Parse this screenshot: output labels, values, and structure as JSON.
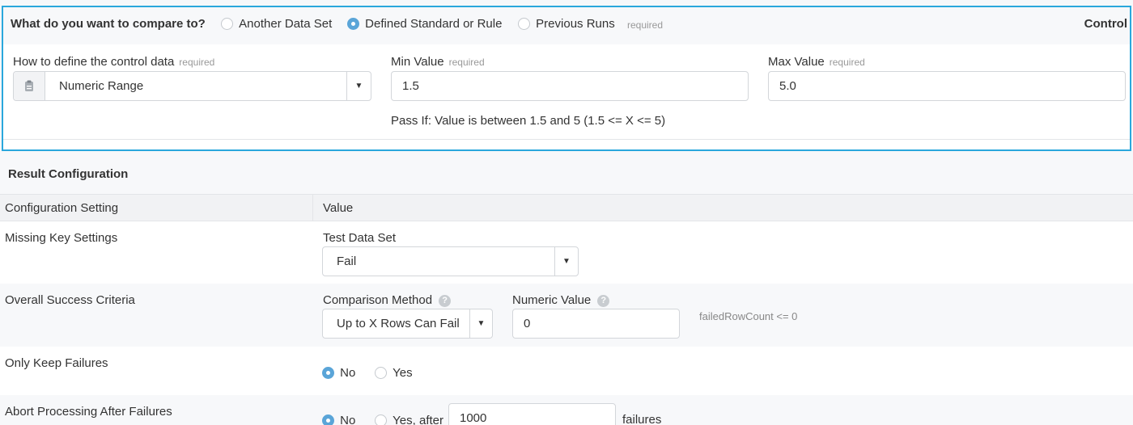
{
  "control": {
    "question": "What do you want to compare to?",
    "options": [
      "Another Data Set",
      "Defined Standard or Rule",
      "Previous Runs"
    ],
    "selected_index": 1,
    "required": "required",
    "section_label": "Control",
    "control_data_label": "How to define the control data",
    "control_data_value": "Numeric Range",
    "min_label": "Min Value",
    "min_value": "1.5",
    "max_label": "Max Value",
    "max_value": "5.0",
    "pass_if": "Pass If: Value is between 1.5 and 5 (1.5 <= X <= 5)"
  },
  "result": {
    "title": "Result Configuration",
    "col_setting": "Configuration Setting",
    "col_value": "Value",
    "missing_key": {
      "label": "Missing Key Settings",
      "sub_label": "Test Data Set",
      "value": "Fail"
    },
    "success": {
      "label": "Overall Success Criteria",
      "method_label": "Comparison Method",
      "method_value": "Up to X Rows Can Fail",
      "numeric_label": "Numeric Value",
      "numeric_value": "0",
      "hint": "failedRowCount <= 0"
    },
    "keep_failures": {
      "label": "Only Keep Failures",
      "no": "No",
      "yes": "Yes",
      "selected": "No"
    },
    "abort": {
      "label": "Abort Processing After Failures",
      "no": "No",
      "yes": "Yes, after",
      "count": "1000",
      "suffix": "failures",
      "selected": "No"
    }
  },
  "icons": {
    "help": "?",
    "dropdown": "▼",
    "clipboard": "clipboard-icon"
  },
  "colors": {
    "accent": "#2aa7dc",
    "radio": "#5aa5d8"
  }
}
